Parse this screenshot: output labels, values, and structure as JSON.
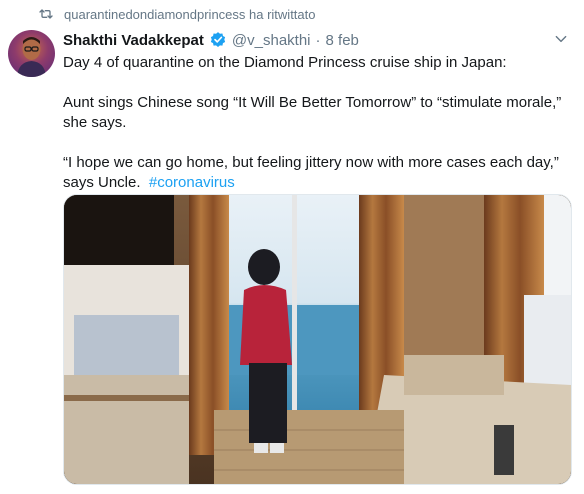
{
  "retweet": {
    "icon": "retweet-icon",
    "text": "quarantinedondiamondprincess ha ritwittato"
  },
  "author": {
    "name": "Shakthi Vadakkepat",
    "verified_icon": "verified-badge-icon",
    "handle": "@v_shakthi",
    "separator": "·",
    "time": "8 feb"
  },
  "tweet": {
    "line1": "Day 4 of quarantine on the Diamond Princess cruise ship in Japan:",
    "line2": "Aunt sings Chinese song “It Will Be Better Tomorrow” to “stimulate morale,” she says.",
    "line3": "“I hope we can go home, but feeling jittery now with more cases each day,” says Uncle.",
    "hashtag": "#coronavirus"
  },
  "menu_icon": "chevron-down-icon",
  "colors": {
    "link": "#1da1f2",
    "secondary_text": "#657786",
    "primary_text": "#14171a"
  }
}
